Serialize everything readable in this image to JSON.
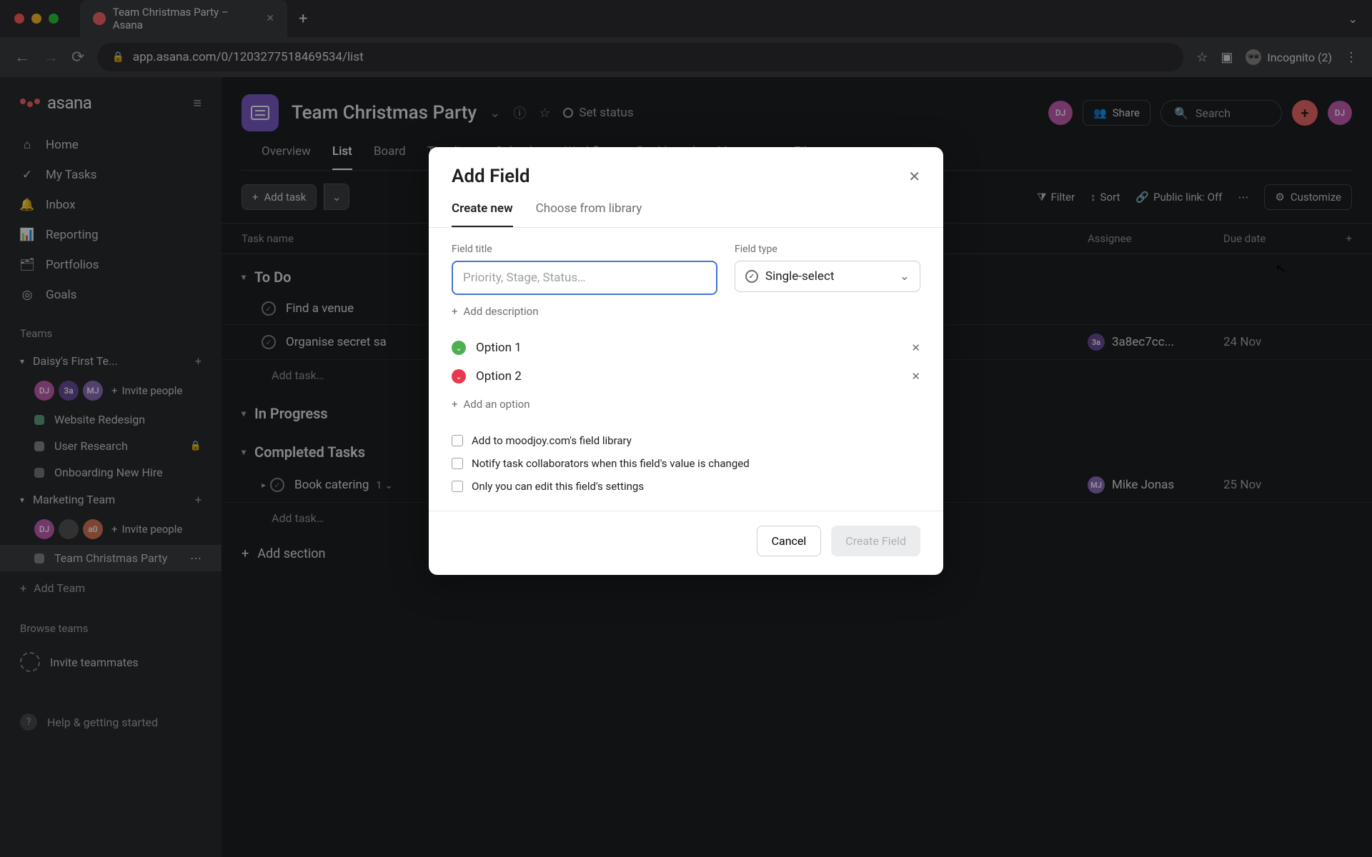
{
  "browser": {
    "tab_title": "Team Christmas Party – Asana",
    "url": "app.asana.com/0/1203277518469534/list",
    "incognito": "Incognito (2)"
  },
  "sidebar": {
    "logo": "asana",
    "nav": {
      "home": "Home",
      "my_tasks": "My Tasks",
      "inbox": "Inbox",
      "reporting": "Reporting",
      "portfolios": "Portfolios",
      "goals": "Goals"
    },
    "teams_label": "Teams",
    "team1": {
      "name": "Daisy's First Te...",
      "members": [
        "DJ",
        "3a",
        "MJ"
      ],
      "invite": "Invite people",
      "projects": {
        "p1": "Website Redesign",
        "p2": "User Research",
        "p3": "Onboarding New Hire"
      }
    },
    "team2": {
      "name": "Marketing Team",
      "members": [
        "DJ",
        "",
        "a0"
      ],
      "invite": "Invite people",
      "active_project": "Team Christmas Party"
    },
    "add_team": "Add Team",
    "browse_teams": "Browse teams",
    "invite_teammates": "Invite teammates",
    "help": "Help & getting started"
  },
  "project": {
    "title": "Team Christmas Party",
    "set_status": "Set status",
    "share": "Share",
    "search": "Search",
    "tabs": {
      "overview": "Overview",
      "list": "List",
      "board": "Board",
      "timeline": "Timeline",
      "calendar": "Calendar",
      "workflow": "Workflow",
      "dashboard": "Dashboard",
      "messages": "Messages",
      "files": "Files"
    }
  },
  "toolbar": {
    "add_task": "Add task",
    "filter": "Filter",
    "sort": "Sort",
    "public_link": "Public link: Off",
    "customize": "Customize"
  },
  "columns": {
    "task_name": "Task name",
    "assignee": "Assignee",
    "due_date": "Due date"
  },
  "sections": {
    "todo": {
      "name": "To Do",
      "tasks": {
        "t1": {
          "name": "Find a venue"
        },
        "t2": {
          "name": "Organise secret sa",
          "assignee_name": "3a8ec7cc...",
          "assignee_init": "3a",
          "due": "24 Nov"
        }
      },
      "add": "Add task…"
    },
    "in_progress": {
      "name": "In Progress"
    },
    "completed": {
      "name": "Completed Tasks",
      "tasks": {
        "t1": {
          "name": "Book catering",
          "subtasks": "1",
          "assignee_name": "Mike Jonas",
          "assignee_init": "MJ",
          "due": "25 Nov"
        }
      },
      "add": "Add task…"
    },
    "add_section": "Add section"
  },
  "modal": {
    "title": "Add Field",
    "tab_create": "Create new",
    "tab_library": "Choose from library",
    "field_title_label": "Field title",
    "field_title_placeholder": "Priority, Stage, Status…",
    "field_type_label": "Field type",
    "field_type_value": "Single-select",
    "add_description": "Add description",
    "option1": "Option 1",
    "option2": "Option 2",
    "add_option": "Add an option",
    "cb1": "Add to moodjoy.com's field library",
    "cb2": "Notify task collaborators when this field's value is changed",
    "cb3": "Only you can edit this field's settings",
    "cancel": "Cancel",
    "create": "Create Field"
  }
}
